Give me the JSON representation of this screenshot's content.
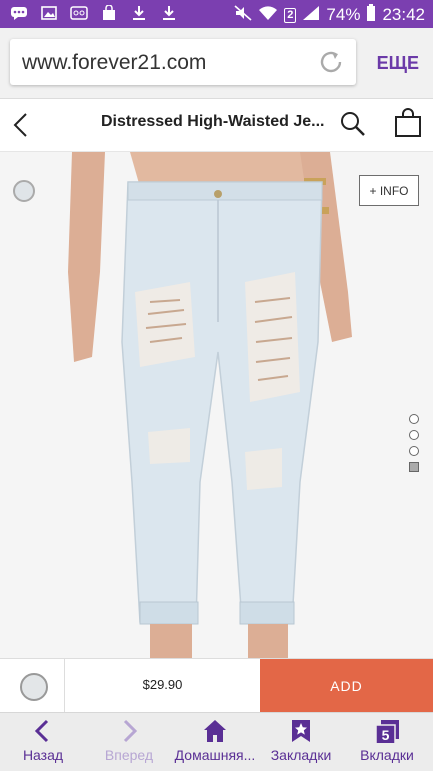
{
  "status_bar": {
    "battery": "74%",
    "time": "23:42",
    "sim_number": "2",
    "notification_icons": [
      "chat-icon",
      "image-icon",
      "voicemail-icon",
      "shopping-bag-icon",
      "download-icon",
      "download-icon"
    ],
    "system_icons": [
      "mute-icon",
      "wifi-icon",
      "signal-icon"
    ]
  },
  "browser": {
    "url": "www.forever21.com",
    "more_label": "ЕЩЕ"
  },
  "product": {
    "title": "Distressed High-Waisted Je...",
    "info_label": "+ INFO",
    "price": "$29.90",
    "add_label": "ADD",
    "image_dots": 4,
    "active_dot": 4
  },
  "nav": {
    "items": [
      {
        "label": "Назад",
        "icon": "chevron-left-icon",
        "enabled": true
      },
      {
        "label": "Вперед",
        "icon": "chevron-right-icon",
        "enabled": false
      },
      {
        "label": "Домашняя...",
        "icon": "home-icon",
        "enabled": true
      },
      {
        "label": "Закладки",
        "icon": "bookmark-star-icon",
        "enabled": true
      },
      {
        "label": "Вкладки",
        "icon": "tabs-icon",
        "enabled": true,
        "badge": "5"
      }
    ]
  },
  "colors": {
    "status_bar": "#7b3fb0",
    "accent": "#5a2f95",
    "add_button": "#e36747"
  }
}
